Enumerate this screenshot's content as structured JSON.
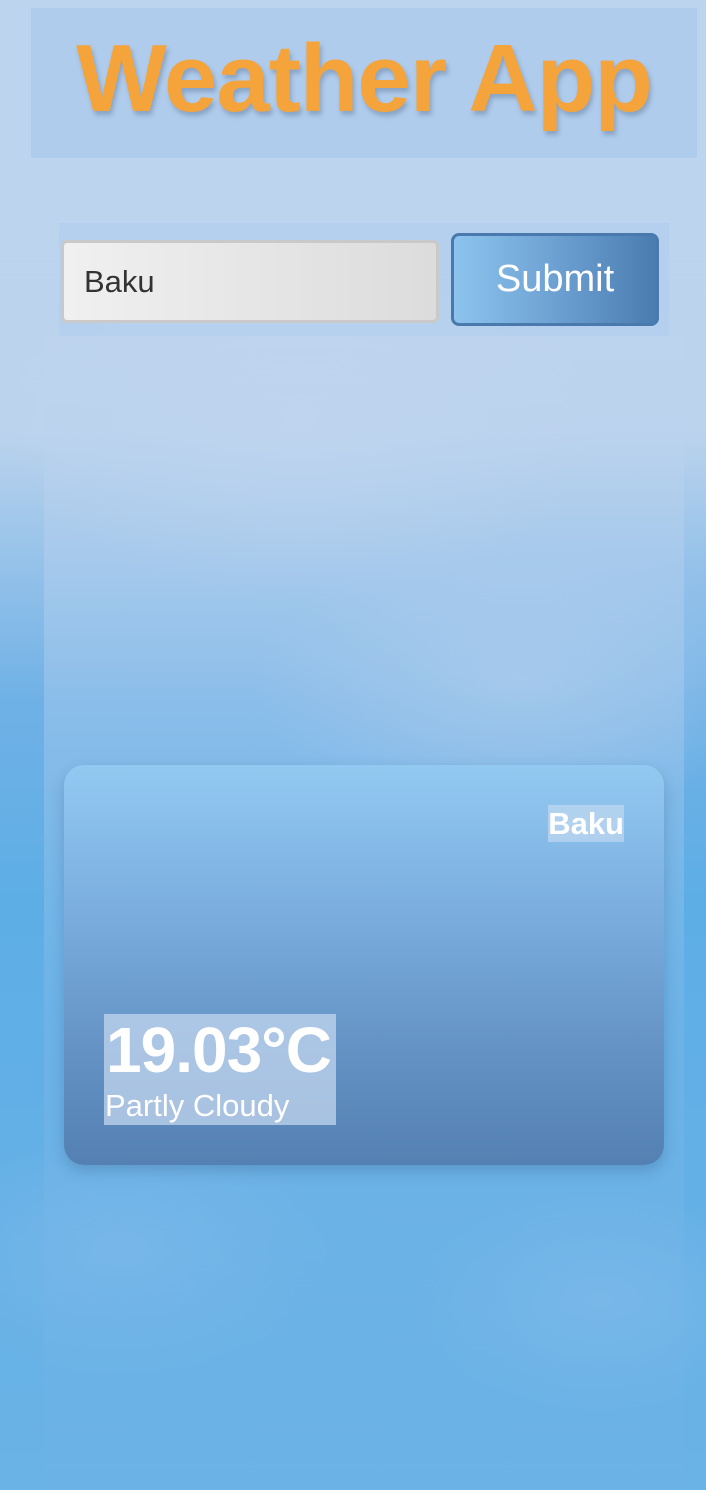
{
  "app": {
    "title": "Weather App"
  },
  "search": {
    "value": "Baku",
    "submit_label": "Submit"
  },
  "weather": {
    "city": "Baku",
    "temperature": "19.03°C",
    "condition": "Partly Cloudy"
  },
  "colors": {
    "title": "#f4a43a",
    "button_start": "#8cc4ee",
    "button_end": "#4a7cb0",
    "card_top": "#92c9f1",
    "card_bottom": "#5480b3"
  }
}
